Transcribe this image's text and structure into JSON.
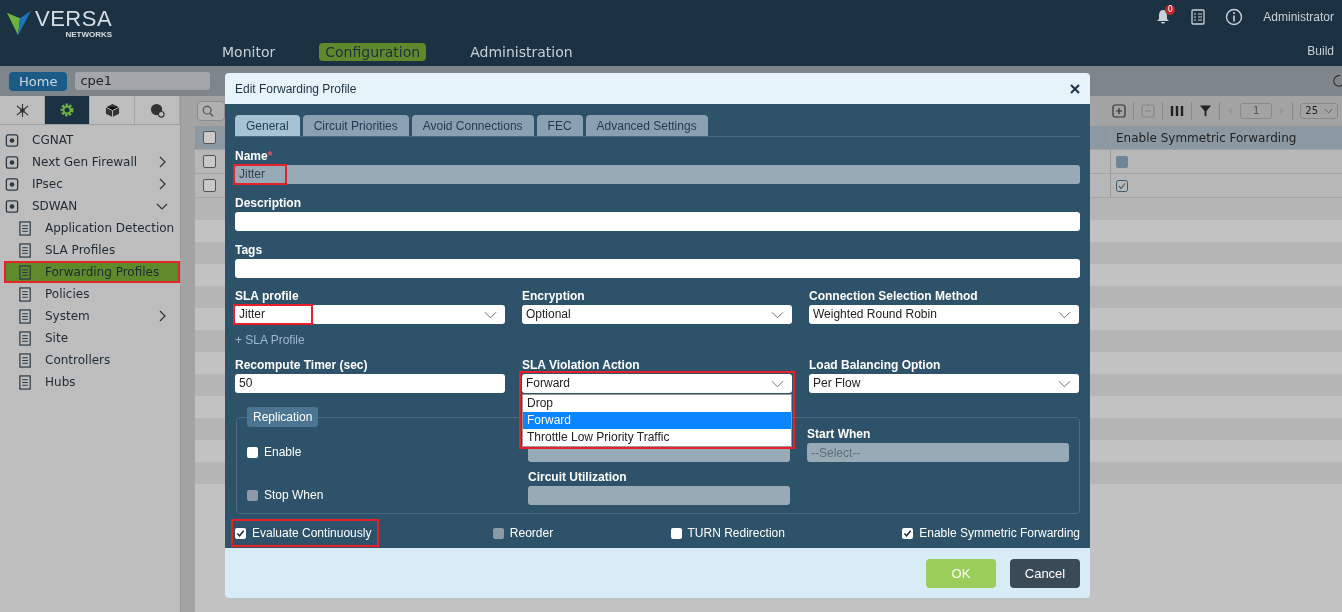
{
  "header": {
    "logo_text": "VERSA",
    "logo_sub": "NETWORKS",
    "nav": [
      {
        "label": "Monitor",
        "selected": false
      },
      {
        "label": "Configuration",
        "selected": true
      },
      {
        "label": "Administration",
        "selected": false
      }
    ],
    "notification_count": "0",
    "user": "Administrator",
    "build": "Build"
  },
  "breadcrumb": {
    "home": "Home",
    "device": "cpe1"
  },
  "sidebar": {
    "tabs": [
      {
        "selected": false
      },
      {
        "selected": true
      },
      {
        "selected": false
      },
      {
        "selected": false
      }
    ],
    "items": [
      {
        "label": "CGNAT",
        "selected": false,
        "highlighted": false
      },
      {
        "label": "Next Gen Firewall",
        "expanded": false,
        "selected": false,
        "highlighted": false
      },
      {
        "label": "IPsec",
        "expanded": false,
        "selected": false,
        "highlighted": false
      },
      {
        "label": "SDWAN",
        "expanded": true,
        "selected": false,
        "highlighted": false,
        "children": [
          {
            "label": "Application Detection",
            "selected": false,
            "highlighted": false
          },
          {
            "label": "SLA Profiles",
            "selected": false,
            "highlighted": false
          },
          {
            "label": "Forwarding Profiles",
            "selected": true,
            "highlighted": true
          },
          {
            "label": "Policies",
            "selected": false,
            "highlighted": false
          },
          {
            "label": "System",
            "expanded": false,
            "selected": false,
            "highlighted": false
          },
          {
            "label": "Site",
            "selected": false,
            "highlighted": false
          },
          {
            "label": "Controllers",
            "selected": false,
            "highlighted": false
          },
          {
            "label": "Hubs",
            "selected": false,
            "highlighted": false
          }
        ]
      }
    ]
  },
  "table": {
    "all_selected": false,
    "page": "1",
    "page_size": "25",
    "columns": [
      {
        "label": "Enable Symmetric Forwarding"
      }
    ],
    "rows": [
      {
        "selected": false,
        "symmetric_forwarding": false
      },
      {
        "selected": false,
        "symmetric_forwarding": true
      }
    ]
  },
  "dialog": {
    "title": "Edit Forwarding Profile",
    "tabs": [
      {
        "label": "General",
        "selected": true
      },
      {
        "label": "Circuit Priorities",
        "selected": false
      },
      {
        "label": "Avoid Connections",
        "selected": false
      },
      {
        "label": "FEC",
        "selected": false
      },
      {
        "label": "Advanced Settings",
        "selected": false
      }
    ],
    "text_fields": [
      {
        "label": "Name",
        "required_marker": "*",
        "value": "Jitter",
        "disabled": true,
        "highlighted": true
      },
      {
        "label": "Description",
        "disabled": false
      },
      {
        "label": "Tags",
        "disabled": false
      }
    ],
    "row_1": [
      {
        "kind": "select",
        "label": "SLA profile",
        "value": "Jitter",
        "highlighted": true
      },
      {
        "kind": "select",
        "label": "Encryption",
        "value": "Optional",
        "highlighted": false
      },
      {
        "kind": "select",
        "label": "Connection Selection Method",
        "value": "Weighted Round Robin",
        "highlighted": false
      }
    ],
    "add_sla_profile": "+ SLA Profile",
    "row_2": [
      {
        "kind": "input",
        "label": "Recompute Timer (sec)",
        "value": "50",
        "highlighted": false
      },
      {
        "kind": "select",
        "label": "SLA Violation Action",
        "value": "Forward",
        "highlighted": true,
        "options": [
          {
            "label": "Drop",
            "selected": false
          },
          {
            "label": "Forward",
            "selected": true
          },
          {
            "label": "Throttle Low Priority Traffic",
            "selected": false
          }
        ]
      },
      {
        "kind": "select",
        "label": "Load Balancing Option",
        "value": "Per Flow",
        "highlighted": false
      }
    ],
    "replication": {
      "legend": "Replication",
      "enable": {
        "label": "Enable",
        "checked": false,
        "disabled": false
      },
      "stop_when": {
        "label": "Stop When",
        "checked": false,
        "disabled": true
      },
      "start_when": {
        "label": "Start When",
        "placeholder": "--Select--"
      },
      "circuit_utilization": {
        "label": "Circuit Utilization"
      }
    },
    "options": [
      {
        "label": "Evaluate Continuously",
        "checked": true,
        "disabled": false,
        "highlighted": true
      },
      {
        "label": "Reorder",
        "checked": false,
        "disabled": true,
        "highlighted": false
      },
      {
        "label": "TURN Redirection",
        "checked": false,
        "disabled": false,
        "highlighted": false
      },
      {
        "label": "Enable Symmetric Forwarding",
        "checked": true,
        "disabled": false,
        "highlighted": false
      }
    ],
    "buttons": [
      {
        "label": "OK",
        "kind": "primary"
      },
      {
        "label": "Cancel",
        "kind": "secondary"
      }
    ]
  }
}
